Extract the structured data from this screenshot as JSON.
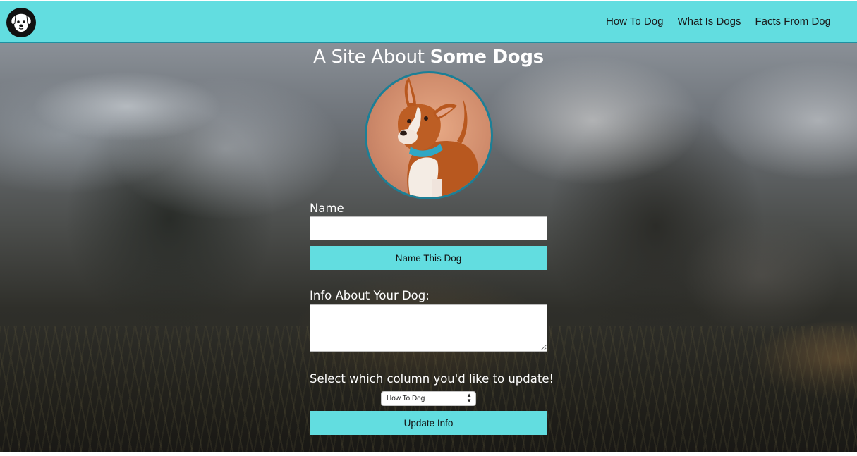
{
  "nav": {
    "logo_icon": "dog-face-icon",
    "links": [
      "How To Dog",
      "What Is Dogs",
      "Facts From Dog"
    ]
  },
  "title": {
    "prefix": "A Site About",
    "bold": "Some Dogs"
  },
  "photo": {
    "icon": "dog-portrait-image"
  },
  "form": {
    "name_label": "Name",
    "name_value": "",
    "name_button": "Name This Dog",
    "info_label": "Info About Your Dog:",
    "info_value": "",
    "column_label": "Select which column you'd like to update!",
    "column_selected": "How To Dog",
    "update_button": "Update Info"
  },
  "colors": {
    "accent": "#62dde0",
    "nav_border": "#1e90a0",
    "photo_border": "#1c7f96"
  }
}
